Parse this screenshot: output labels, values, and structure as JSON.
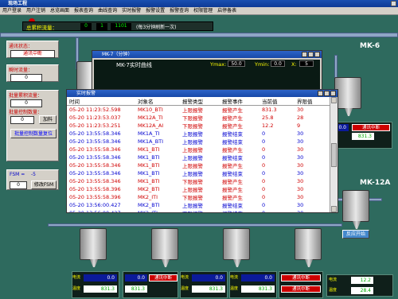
{
  "app": {
    "title": "现场工程"
  },
  "menu": [
    "用户登录",
    "用户注销",
    "总览画面",
    "报表查询",
    "曲线查询",
    "实时报警",
    "报警设置",
    "报警查询",
    "权限管理",
    "启停备表"
  ],
  "flow": {
    "label": "总累积流量：",
    "v1": "0",
    "v2": "1",
    "v3": "1101",
    "note": "(每3分钟刷新一次)"
  },
  "left": {
    "comm_label": "通讯状态：",
    "comm_value": "通讯中断",
    "instant_label": "瞬时流量：",
    "instant_value": "0",
    "batch_label": "批量累积流量：",
    "batch_value": "0",
    "ctrl_label": "批量控制数量：",
    "ctrl_value": "0",
    "add_btn": "加料",
    "reset_btn": "批量控制数量复位",
    "fsm_label": "FSM =",
    "fsm_value": "-5",
    "fsm_input": "0",
    "fsm_btn": "修改FSM"
  },
  "tanks": {
    "mk6": "MK-6",
    "mk12a": "MK-12A",
    "bottom_btn": "反应开始"
  },
  "curve_window": {
    "title": "MK-7（分钟）",
    "chart_title": "MK-7实时曲线",
    "ymax_label": "Ymax:",
    "ymax": "50.0",
    "ymin_label": "Ymin:",
    "ymin": "0.0",
    "x_label": "X:",
    "x": "5"
  },
  "alarm_window": {
    "title": "实时报警",
    "headers": [
      "时间",
      "对象名",
      "报警类型",
      "报警事件",
      "当前值",
      "界限值"
    ],
    "rows": [
      {
        "time": "05-20 11:23:52.598",
        "obj": "MK10_BTI",
        "type": "上限报警",
        "event": "报警产生",
        "cur": "831.3",
        "lim": "30",
        "c": "#d00000"
      },
      {
        "time": "05-20 11:23:53.037",
        "obj": "MK12A_TI",
        "type": "下限报警",
        "event": "报警产生",
        "cur": "25.8",
        "lim": "28",
        "c": "#d00000"
      },
      {
        "time": "05-20 11:23:53.251",
        "obj": "MK12A_AI",
        "type": "下限报警",
        "event": "报警产生",
        "cur": "12.2",
        "lim": "9",
        "c": "#d00000"
      },
      {
        "time": "05-20 13:55:58.346",
        "obj": "MK1A_TI",
        "type": "上限报警",
        "event": "报警结束",
        "cur": "0",
        "lim": "30",
        "c": "#0000d0"
      },
      {
        "time": "05-20 13:55:58.346",
        "obj": "MK1A_BTI",
        "type": "上限报警",
        "event": "报警结束",
        "cur": "0",
        "lim": "30",
        "c": "#0000d0"
      },
      {
        "time": "05-20 13:55:58.346",
        "obj": "MK1_BTI",
        "type": "上限报警",
        "event": "报警产生",
        "cur": "0",
        "lim": "30",
        "c": "#d00000"
      },
      {
        "time": "05-20 13:55:58.346",
        "obj": "MK1_BTI",
        "type": "上限报警",
        "event": "报警结束",
        "cur": "0",
        "lim": "30",
        "c": "#0000d0"
      },
      {
        "time": "05-20 13:55:58.346",
        "obj": "MK1_BTI",
        "type": "上限报警",
        "event": "报警产生",
        "cur": "0",
        "lim": "30",
        "c": "#d00000"
      },
      {
        "time": "05-20 13:55:58.346",
        "obj": "MK1_BTI",
        "type": "上限报警",
        "event": "报警结束",
        "cur": "0",
        "lim": "30",
        "c": "#0000d0"
      },
      {
        "time": "05-20 13:55:58.346",
        "obj": "MK1_BTI",
        "type": "下限报警",
        "event": "报警产生",
        "cur": "0",
        "lim": "30",
        "c": "#d00000"
      },
      {
        "time": "05-20 13:55:58.396",
        "obj": "MK2_BTI",
        "type": "上限报警",
        "event": "报警产生",
        "cur": "0",
        "lim": "30",
        "c": "#d00000"
      },
      {
        "time": "05-20 13:55:58.396",
        "obj": "MK2_ITI",
        "type": "下限报警",
        "event": "报警产生",
        "cur": "0",
        "lim": "30",
        "c": "#d00000"
      },
      {
        "time": "05-20 13:56:00.427",
        "obj": "MK2_BTI",
        "type": "上限报警",
        "event": "报警结束",
        "cur": "0",
        "lim": "30",
        "c": "#0000d0"
      },
      {
        "time": "05-20 13:56:00.427",
        "obj": "MK2_ITI",
        "type": "下限报警",
        "event": "报警结束",
        "cur": "0",
        "lim": "30",
        "c": "#0000d0"
      },
      {
        "time": "05-20 13:56:05.440",
        "obj": "MK3_BTI",
        "type": "上限报警",
        "event": "报警产生",
        "cur": "0",
        "lim": "30",
        "c": "#d00000"
      }
    ]
  },
  "gauges": [
    {
      "l1": "电流",
      "v1": "0.0",
      "u1": "A",
      "l2": "温度",
      "v2": "831.3",
      "u2": "℃"
    },
    {
      "l1": "电流",
      "v1": "0.0",
      "u1": "A",
      "l2": "温度",
      "v2": "831.3",
      "u2": "℃"
    },
    {
      "l1": "电流",
      "v1": "0.0",
      "u1": "A",
      "l2": "温度",
      "v2": "831.3",
      "u2": "℃"
    },
    {
      "l1": "电流",
      "v1": "0.0",
      "u1": "A",
      "l2": "温度",
      "v2": "831.3",
      "u2": "℃"
    },
    {
      "l1": "电流",
      "v1": "0.0",
      "u1": "A",
      "l2": "温度",
      "v2": "831.3",
      "u2": "℃"
    }
  ],
  "alarm_boxes": [
    "通讯中断",
    "通讯中断",
    "通讯中断",
    "通讯中断"
  ],
  "right_gauges": [
    {
      "l1": "电流",
      "v1": "0.0",
      "u1": "A",
      "alarm": "通讯中断",
      "l2": "温度",
      "v2": "831.3",
      "u2": "℃"
    },
    {
      "l1": "电流",
      "v1": "0.0",
      "u1": "A",
      "alarm": "通讯中断",
      "l2": "温度",
      "v2": "831.3",
      "u2": "℃"
    }
  ],
  "mk12_gauge": {
    "l1": "电流",
    "v1": "12.2",
    "u1": "A",
    "l2": "温度",
    "v2": "28.4",
    "u2": "℃"
  }
}
